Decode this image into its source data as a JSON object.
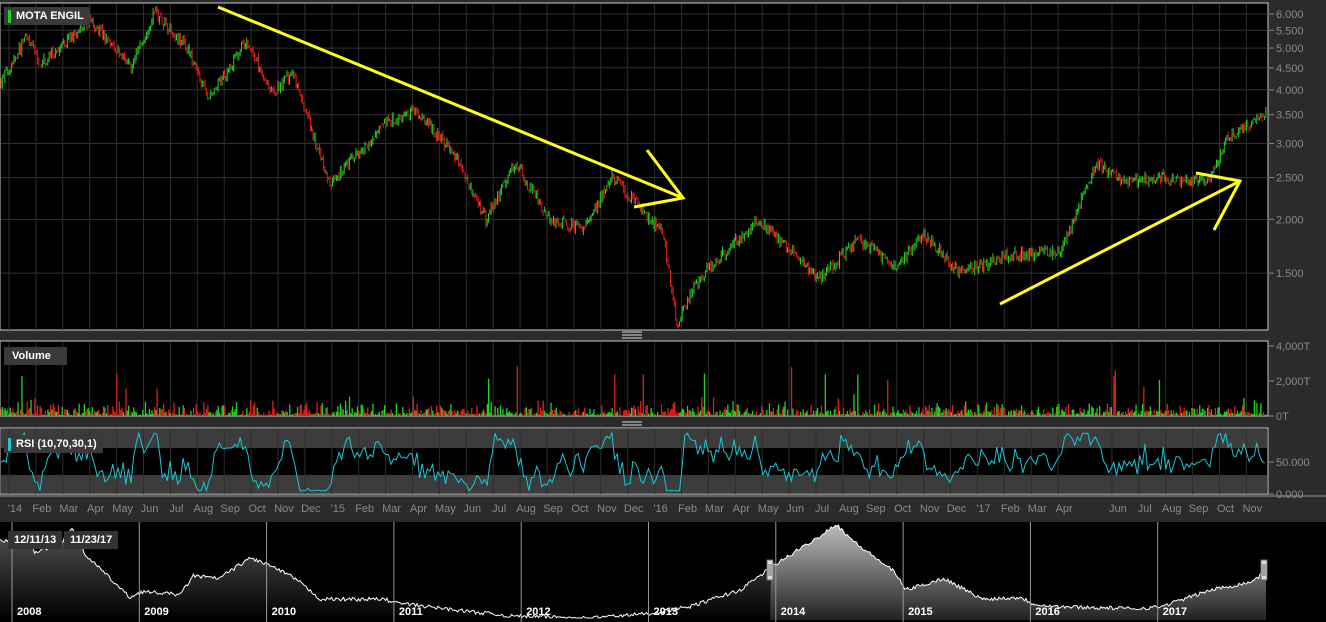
{
  "chart_data": {
    "type": "candlestick",
    "title": "MOTA ENGIL",
    "price_axis": {
      "ticks": [
        6.0,
        5.5,
        5.0,
        4.5,
        4.0,
        3.5,
        3.0,
        2.5,
        2.0,
        1.5
      ],
      "labels": [
        "6.000",
        "5.500",
        "5.000",
        "4.500",
        "4.000",
        "3.500",
        "3.000",
        "2.500",
        "2.000",
        "1.500"
      ],
      "scale": "log"
    },
    "price_keypoints_month_index": [
      [
        -0.5,
        4.2
      ],
      [
        0.4,
        5.3
      ],
      [
        1.0,
        4.6
      ],
      [
        2.8,
        5.8
      ],
      [
        4.3,
        4.5
      ],
      [
        5.2,
        6.1
      ],
      [
        6.4,
        5.0
      ],
      [
        7.2,
        3.8
      ],
      [
        8.6,
        5.2
      ],
      [
        9.6,
        3.9
      ],
      [
        10.3,
        4.4
      ],
      [
        11.7,
        2.4
      ],
      [
        12.4,
        2.7
      ],
      [
        13.7,
        3.3
      ],
      [
        14.9,
        3.6
      ],
      [
        16.4,
        2.8
      ],
      [
        17.5,
        2.0
      ],
      [
        18.6,
        2.7
      ],
      [
        19.9,
        2.0
      ],
      [
        21.1,
        1.9
      ],
      [
        22.2,
        2.5
      ],
      [
        24.1,
        1.85
      ],
      [
        24.6,
        1.15
      ],
      [
        25.4,
        1.45
      ],
      [
        27.6,
        2.0
      ],
      [
        29.9,
        1.45
      ],
      [
        31.4,
        1.8
      ],
      [
        32.7,
        1.55
      ],
      [
        33.8,
        1.85
      ],
      [
        35.1,
        1.5
      ],
      [
        37.0,
        1.65
      ],
      [
        38.9,
        1.7
      ],
      [
        40.2,
        2.7
      ],
      [
        41.3,
        2.45
      ],
      [
        42.7,
        2.5
      ],
      [
        44.4,
        2.45
      ],
      [
        45.1,
        3.1
      ],
      [
        46.4,
        3.5
      ],
      [
        47.0,
        3.4
      ]
    ],
    "volume": {
      "label": "Volume",
      "ticks": [
        "4,000T",
        "2,000T",
        "0T"
      ],
      "tick_values": [
        4000,
        2000,
        0
      ],
      "unit": "T"
    },
    "rsi": {
      "label": "RSI (10,70,30,1)",
      "ticks": [
        "50.000",
        "0.000"
      ],
      "tick_values": [
        50,
        0
      ],
      "upper_band": 70,
      "lower_band": 30
    },
    "x_axis": {
      "labels": [
        {
          "t": "'14",
          "m": 0
        },
        {
          "t": "Feb",
          "m": 1
        },
        {
          "t": "Mar",
          "m": 2
        },
        {
          "t": "Apr",
          "m": 3
        },
        {
          "t": "May",
          "m": 4
        },
        {
          "t": "Jun",
          "m": 5
        },
        {
          "t": "Jul",
          "m": 6
        },
        {
          "t": "Aug",
          "m": 7
        },
        {
          "t": "Sep",
          "m": 8
        },
        {
          "t": "Oct",
          "m": 9
        },
        {
          "t": "Nov",
          "m": 10
        },
        {
          "t": "Dec",
          "m": 11
        },
        {
          "t": "'15",
          "m": 12
        },
        {
          "t": "Feb",
          "m": 13
        },
        {
          "t": "Mar",
          "m": 14
        },
        {
          "t": "Apr",
          "m": 15
        },
        {
          "t": "May",
          "m": 16
        },
        {
          "t": "Jun",
          "m": 17
        },
        {
          "t": "Jul",
          "m": 18
        },
        {
          "t": "Aug",
          "m": 19
        },
        {
          "t": "Sep",
          "m": 20
        },
        {
          "t": "Oct",
          "m": 21
        },
        {
          "t": "Nov",
          "m": 22
        },
        {
          "t": "Dec",
          "m": 23
        },
        {
          "t": "'16",
          "m": 24
        },
        {
          "t": "Feb",
          "m": 25
        },
        {
          "t": "Mar",
          "m": 26
        },
        {
          "t": "Apr",
          "m": 27
        },
        {
          "t": "May",
          "m": 28
        },
        {
          "t": "Jun",
          "m": 29
        },
        {
          "t": "Jul",
          "m": 30
        },
        {
          "t": "Aug",
          "m": 31
        },
        {
          "t": "Sep",
          "m": 32
        },
        {
          "t": "Oct",
          "m": 33
        },
        {
          "t": "Nov",
          "m": 34
        },
        {
          "t": "Dec",
          "m": 35
        },
        {
          "t": "'17",
          "m": 36
        },
        {
          "t": "Feb",
          "m": 37
        },
        {
          "t": "Mar",
          "m": 38
        },
        {
          "t": "Apr",
          "m": 39
        },
        {
          "t": "Jun",
          "m": 41
        },
        {
          "t": "Jul",
          "m": 42
        },
        {
          "t": "Aug",
          "m": 43
        },
        {
          "t": "Sep",
          "m": 44
        },
        {
          "t": "Oct",
          "m": 45
        },
        {
          "t": "Nov",
          "m": 46
        }
      ]
    },
    "navigator": {
      "start_date": "12/11/13",
      "end_date": "11/23/17",
      "years": [
        "2008",
        "2009",
        "2010",
        "2011",
        "2012",
        "2013",
        "2014",
        "2015",
        "2016",
        "2017"
      ],
      "keypoints_year": [
        [
          2008.0,
          0.82
        ],
        [
          2008.1,
          0.9
        ],
        [
          2008.15,
          0.7
        ],
        [
          2008.35,
          0.78
        ],
        [
          2008.45,
          0.96
        ],
        [
          2008.55,
          0.68
        ],
        [
          2008.9,
          0.22
        ],
        [
          2009.0,
          0.28
        ],
        [
          2009.3,
          0.25
        ],
        [
          2009.4,
          0.45
        ],
        [
          2009.6,
          0.42
        ],
        [
          2009.85,
          0.64
        ],
        [
          2010.0,
          0.56
        ],
        [
          2010.2,
          0.42
        ],
        [
          2010.4,
          0.2
        ],
        [
          2010.9,
          0.2
        ],
        [
          2011.0,
          0.16
        ],
        [
          2011.5,
          0.08
        ],
        [
          2011.9,
          0.02
        ],
        [
          2012.0,
          0.02
        ],
        [
          2012.5,
          0.0
        ],
        [
          2013.0,
          0.05
        ],
        [
          2013.3,
          0.12
        ],
        [
          2013.7,
          0.3
        ],
        [
          2013.95,
          0.55
        ],
        [
          2014.3,
          0.85
        ],
        [
          2014.45,
          1.0
        ],
        [
          2014.6,
          0.8
        ],
        [
          2014.9,
          0.5
        ],
        [
          2015.0,
          0.3
        ],
        [
          2015.3,
          0.42
        ],
        [
          2015.6,
          0.2
        ],
        [
          2015.9,
          0.22
        ],
        [
          2016.0,
          0.15
        ],
        [
          2016.2,
          0.12
        ],
        [
          2016.8,
          0.1
        ],
        [
          2017.0,
          0.12
        ],
        [
          2017.4,
          0.3
        ],
        [
          2017.7,
          0.38
        ],
        [
          2017.9,
          0.55
        ]
      ]
    },
    "annotations": [
      "downtrend-arrow",
      "uptrend-arrow"
    ]
  },
  "colors": {
    "up": "#1fd41f",
    "down": "#e0201a",
    "rsi": "#17c8d8",
    "annotation": "#ffff1a"
  }
}
